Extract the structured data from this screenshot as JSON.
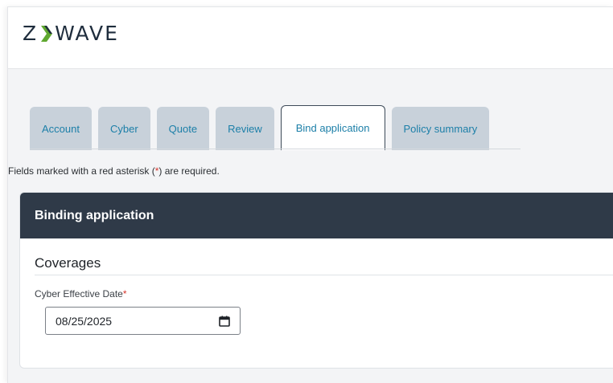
{
  "logo": {
    "left": "Z",
    "right": "WAVE",
    "brand_color": "#1f2d3d",
    "chevron_color": "#5fa830"
  },
  "tabs": [
    {
      "label": "Account",
      "active": false
    },
    {
      "label": "Cyber",
      "active": false
    },
    {
      "label": "Quote",
      "active": false
    },
    {
      "label": "Review",
      "active": false
    },
    {
      "label": "Bind application",
      "active": true
    },
    {
      "label": "Policy summary",
      "active": false
    }
  ],
  "required_note": {
    "before": "Fields marked with a red asterisk (",
    "asterisk": "*",
    "after": ") are required."
  },
  "card": {
    "title": "Binding application",
    "section_title": "Coverages",
    "field": {
      "label": "Cyber Effective Date",
      "required_mark": "*",
      "value": "08/25/2025",
      "icon": "calendar-icon"
    }
  },
  "colors": {
    "tab_text": "#1c7fa8",
    "card_header": "#2f3a48",
    "required": "#d6342b"
  }
}
